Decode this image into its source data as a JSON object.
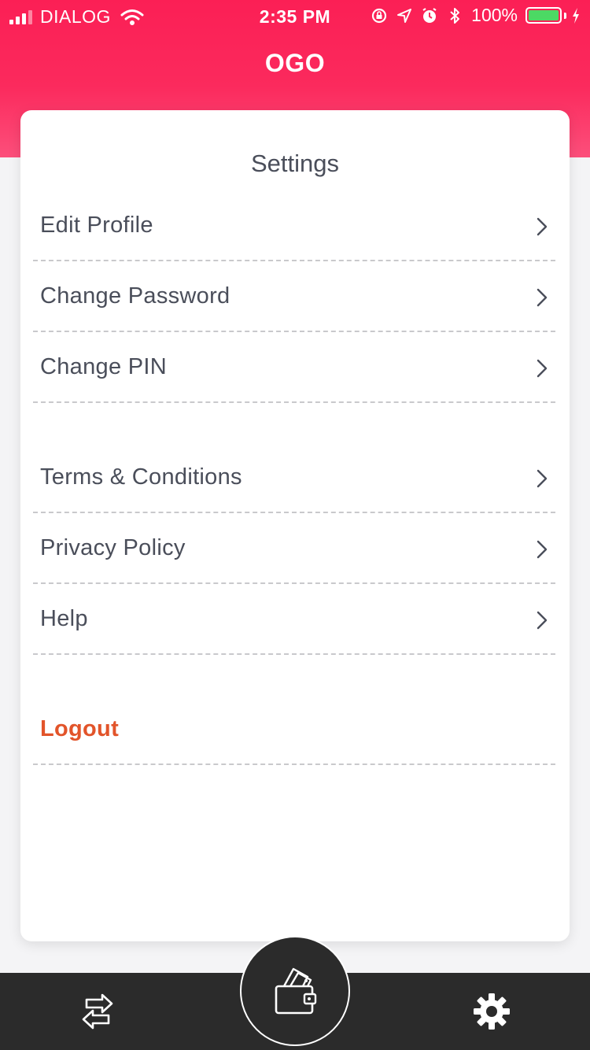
{
  "status_bar": {
    "carrier": "DIALOG",
    "time": "2:35 PM",
    "battery": "100%",
    "battery_level": 1.0,
    "icons": [
      "signal-icon",
      "wifi-icon",
      "orientation-lock-icon",
      "location-icon",
      "alarm-icon",
      "bluetooth-icon",
      "battery-icon",
      "charging-icon"
    ]
  },
  "header": {
    "title": "OGO"
  },
  "settings": {
    "title": "Settings",
    "items": [
      {
        "label": "Edit Profile"
      },
      {
        "label": "Change Password"
      },
      {
        "label": "Change PIN"
      },
      {
        "label": "Terms & Conditions"
      },
      {
        "label": "Privacy Policy"
      },
      {
        "label": "Help"
      }
    ],
    "logout_label": "Logout"
  },
  "tab_bar": {
    "tabs": [
      "transfer-icon",
      "wallet-icon",
      "gear-icon"
    ]
  },
  "colors": {
    "header_top": "#fb1f55",
    "header_bottom": "#fc4f7b",
    "logout": "#e2542a",
    "text": "#4a4e5a",
    "tab_bar": "#2b2b2b",
    "battery_fill": "#4cd964"
  }
}
